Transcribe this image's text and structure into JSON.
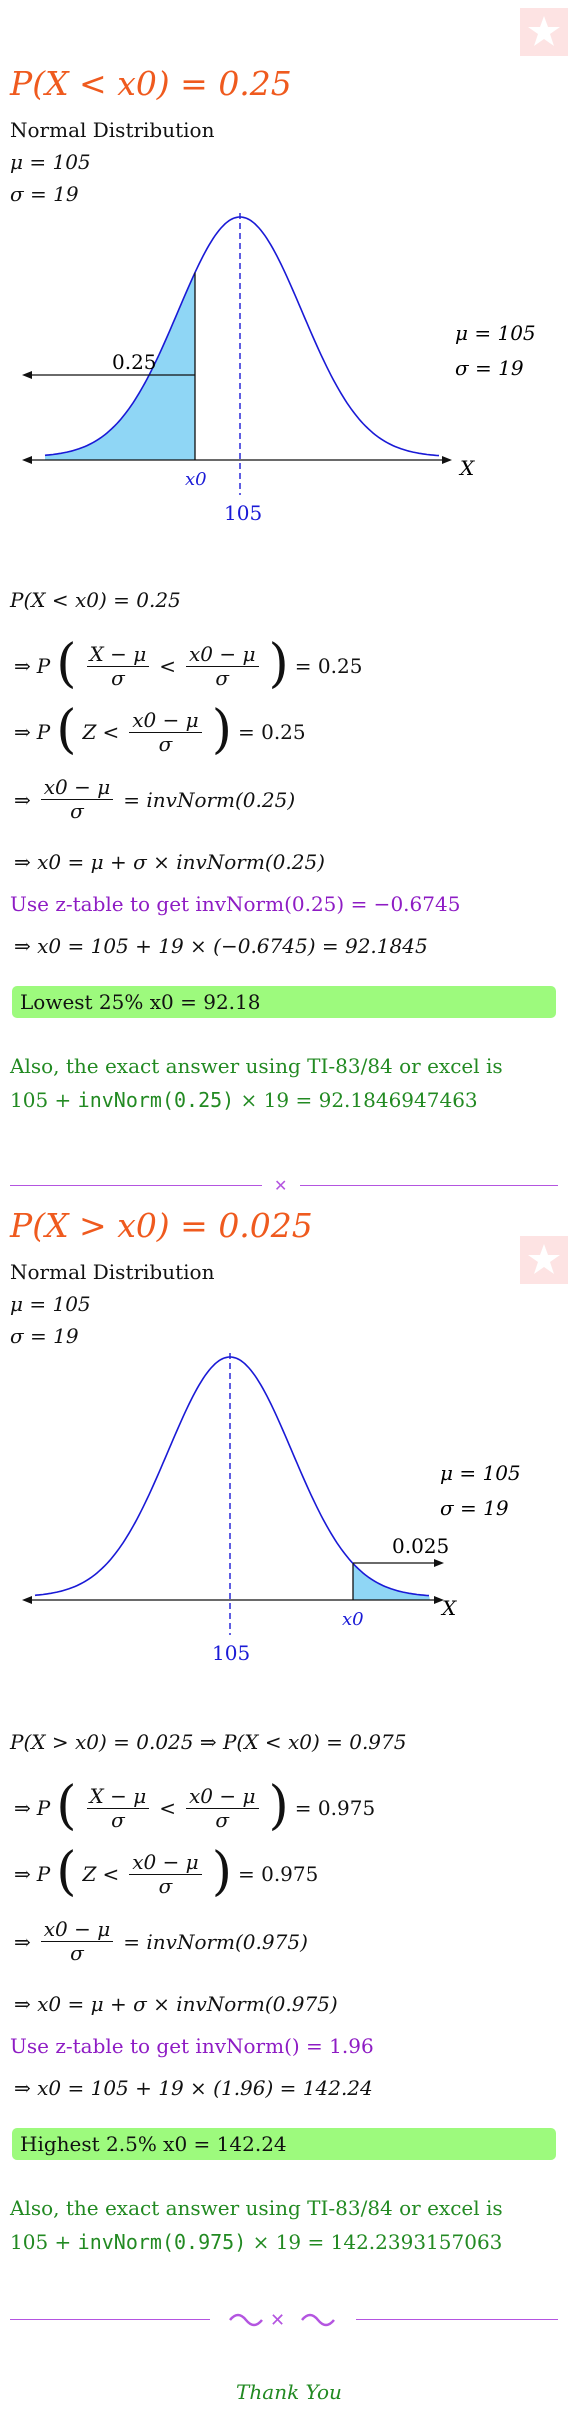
{
  "section1": {
    "title": "P(X < x0) = 0.25",
    "dist_label": "Normal Distribution",
    "mu_label": "μ = 105",
    "sigma_label": "σ = 19",
    "graph": {
      "area_label": "0.25",
      "x0_label": "x0",
      "mean_label": "105",
      "axis_label": "X",
      "legend_mu": "μ = 105",
      "legend_sigma": "σ = 19"
    },
    "step0": "P(X < x0) = 0.25",
    "step1_rhs": "= 0.25",
    "step2_rhs": "= 0.25",
    "step3_rhs": "= invNorm(0.25)",
    "step4": "⇒ x0 = μ + σ × invNorm(0.25)",
    "ztable_note": "Use z-table to get invNorm(0.25) = −0.6745",
    "step5": "⇒ x0 = 105 + 19 × (−0.6745) = 92.1845",
    "answer": "Lowest 25% x0 = 92.18",
    "exact_intro": "Also, the exact answer using TI-83/84 or excel is",
    "exact_prefix": "105 + ",
    "exact_fn": "invNorm(0.25)",
    "exact_suffix": " × 19 = 92.1846947463"
  },
  "section2": {
    "title": "P(X > x0) = 0.025",
    "dist_label": "Normal Distribution",
    "mu_label": "μ = 105",
    "sigma_label": "σ = 19",
    "graph": {
      "area_label": "0.025",
      "x0_label": "x0",
      "mean_label": "105",
      "axis_label": "X",
      "legend_mu": "μ = 105",
      "legend_sigma": "σ = 19"
    },
    "step0": "P(X > x0) = 0.025 ⇒ P(X < x0) = 0.975",
    "step1_rhs": "= 0.975",
    "step2_rhs": "= 0.975",
    "step3_rhs": "= invNorm(0.975)",
    "step4": "⇒ x0 = μ + σ × invNorm(0.975)",
    "ztable_note": "Use z-table to get invNorm() = 1.96",
    "step5": "⇒ x0 = 105 + 19 × (1.96) = 142.24",
    "answer": "Highest 2.5% x0 = 142.24",
    "exact_intro": "Also, the exact answer using TI-83/84 or excel is",
    "exact_prefix": "105 + ",
    "exact_fn": "invNorm(0.975)",
    "exact_suffix": " × 19 = 142.2393157063"
  },
  "common": {
    "frac_num": "X − μ",
    "frac_den": "σ",
    "frac2_num": "x0 − μ",
    "frac2_den": "σ",
    "implies": "⇒",
    "P": "P",
    "Z": "Z",
    "lt": "<"
  },
  "footer": {
    "thank_you": "Thank You"
  },
  "colors": {
    "title": "#ef5a1e",
    "curve": "#1a1ad6",
    "shade": "#8fd6f5",
    "answer_bg": "#9dfa7d",
    "note": "#8e1cc4",
    "exact": "#228a22"
  }
}
